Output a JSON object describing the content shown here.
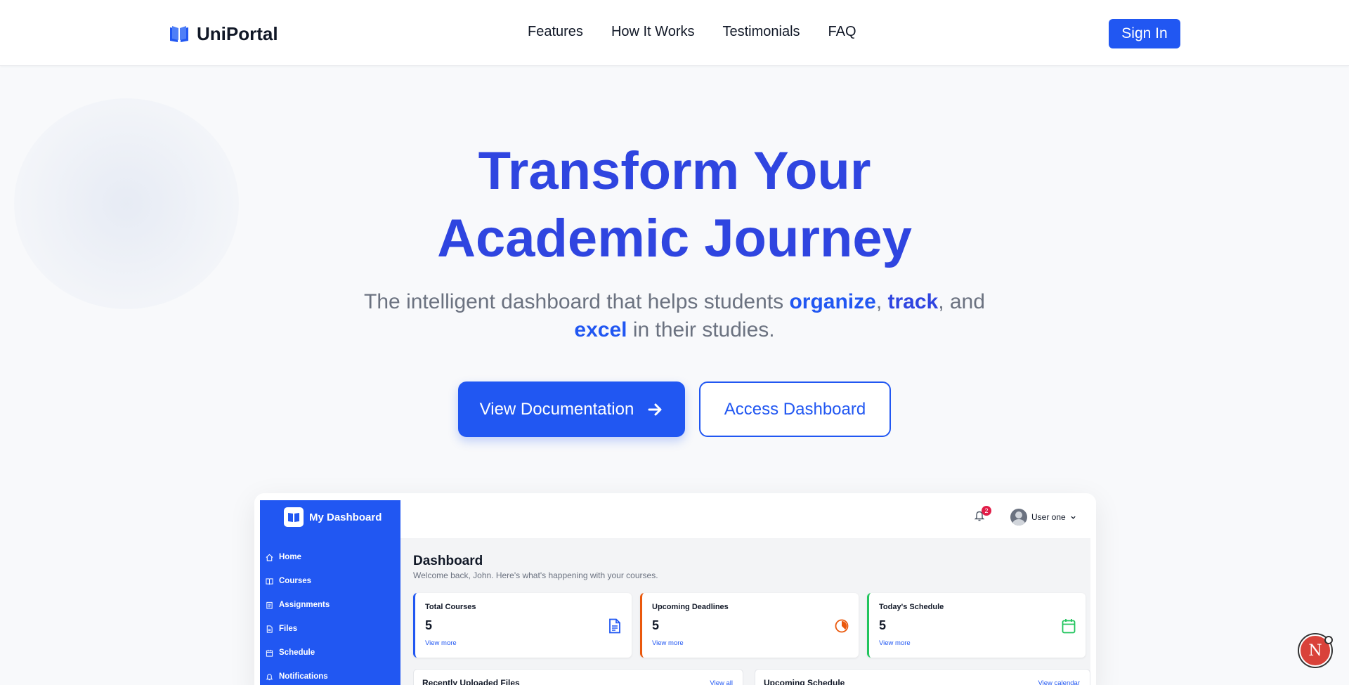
{
  "header": {
    "brand": "UniPortal",
    "nav": [
      "Features",
      "How It Works",
      "Testimonials",
      "FAQ"
    ],
    "signin": "Sign In"
  },
  "hero": {
    "title_line1": "Transform Your",
    "title_line2": "Academic Journey",
    "sub_part1": "The intelligent dashboard that helps students ",
    "sub_hl1": "organize",
    "sub_comma": ", ",
    "sub_hl2": "track",
    "sub_part2": ", and",
    "sub_hl3": "excel",
    "sub_part3": " in their studies.",
    "primary_button": "View Documentation",
    "secondary_button": "Access Dashboard"
  },
  "preview": {
    "brand": "My Dashboard",
    "nav": [
      "Home",
      "Courses",
      "Assignments",
      "Files",
      "Schedule",
      "Notifications"
    ],
    "notification_count": "2",
    "user": "User one",
    "title": "Dashboard",
    "welcome": "Welcome back, John. Here's what's happening with your courses.",
    "cards": [
      {
        "title": "Total Courses",
        "value": "5",
        "link": "View more",
        "accent": "#2157f2"
      },
      {
        "title": "Upcoming Deadlines",
        "value": "5",
        "link": "View more",
        "accent": "#ea580c"
      },
      {
        "title": "Today's Schedule",
        "value": "5",
        "link": "View more",
        "accent": "#22c55e"
      }
    ],
    "panels": [
      {
        "title": "Recently Uploaded Files",
        "link": "View all"
      },
      {
        "title": "Upcoming Schedule",
        "link": "View calendar"
      }
    ]
  },
  "fab": {
    "letter": "N"
  },
  "colors": {
    "primary": "#2157f2",
    "title": "#2f45e0",
    "muted": "#6b7280"
  }
}
